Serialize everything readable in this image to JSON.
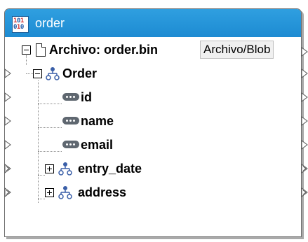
{
  "component": {
    "title": "order",
    "title_icon_rows": [
      "101",
      "010"
    ]
  },
  "tree": {
    "root": {
      "label": "Archivo: order.bin",
      "blob_button": "Archivo/Blob"
    },
    "order": {
      "label": "Order"
    },
    "fields": [
      {
        "label": "id"
      },
      {
        "label": "name"
      },
      {
        "label": "email"
      }
    ],
    "collapsed": [
      {
        "label": "entry_date"
      },
      {
        "label": "address"
      }
    ]
  },
  "colors": {
    "titlebar": "#1d8bd2",
    "element_icon": "#3a5fa8",
    "attribute_icon": "#5f6770"
  },
  "icons": {
    "title": "binary-file-icon",
    "file": "file-icon",
    "element": "element-tree-icon",
    "attribute": "attribute-icon"
  }
}
